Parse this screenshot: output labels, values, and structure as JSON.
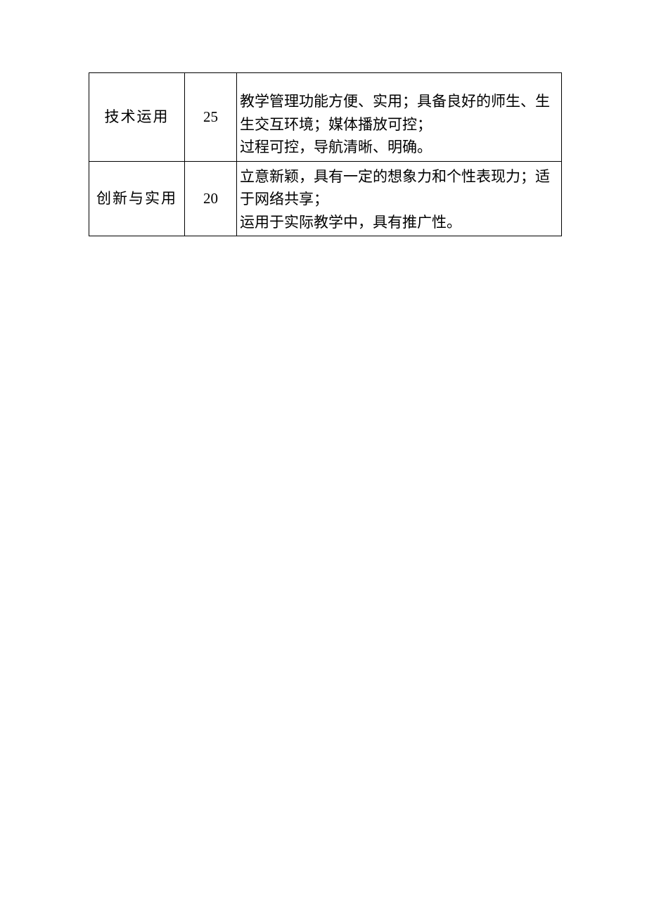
{
  "table": {
    "rows": [
      {
        "category": "技术运用",
        "score": "25",
        "desc_lines": [
          "教学管理功能方便、实用；具备良好的师生、生生交互环境；媒体播放可控；",
          "过程可控，导航清晰、明确。"
        ]
      },
      {
        "category": "创新与实用",
        "score": "20",
        "desc_lines": [
          "立意新颖，具有一定的想象力和个性表现力；适于网络共享；",
          "运用于实际教学中，具有推广性。"
        ]
      }
    ]
  }
}
